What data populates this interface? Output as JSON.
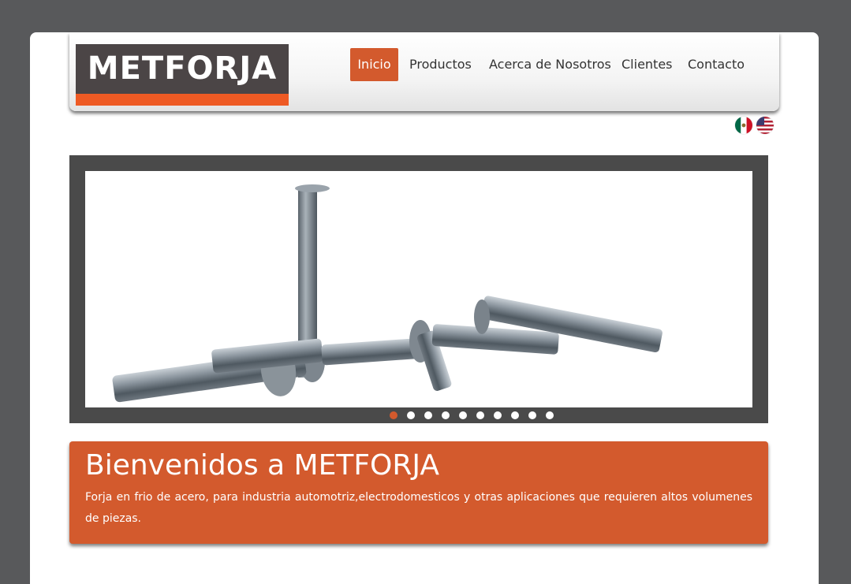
{
  "brand": {
    "logo_text": "METFORJA",
    "logo_bg": "#4b4546",
    "logo_accent": "#ee5a24"
  },
  "nav": {
    "items": [
      {
        "label": "Inicio",
        "active": true
      },
      {
        "label": "Productos",
        "active": false
      },
      {
        "label": "Acerca de Nosotros",
        "active": false
      },
      {
        "label": "Clientes",
        "active": false
      },
      {
        "label": "Contacto",
        "active": false
      }
    ]
  },
  "languages": [
    {
      "icon": "mexico-flag-icon"
    },
    {
      "icon": "usa-flag-icon"
    }
  ],
  "slider": {
    "image": "steel-rivets-product-image",
    "total_slides": 10,
    "active_slide": 1
  },
  "welcome": {
    "title": "Bienvenidos a METFORJA",
    "description": "Forja en frio de acero, para industria automotriz,electrodomesticos y otras aplicaciones que requieren altos volumenes de piezas."
  },
  "colors": {
    "accent": "#d35a2d",
    "background": "#58595b",
    "slider_frame": "#4a4a4a"
  }
}
